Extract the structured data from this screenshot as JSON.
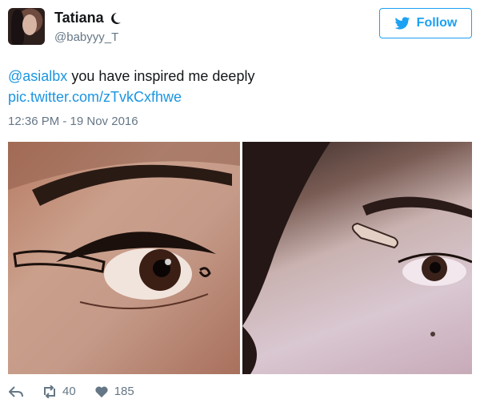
{
  "user": {
    "name": "Tatiana",
    "handle": "@babyyy_T",
    "name_icon": "crescent-moon-icon"
  },
  "follow": {
    "label": "Follow",
    "icon": "twitter-bird-icon"
  },
  "tweet": {
    "mention": "@asialbx",
    "text": " you have inspired me deeply",
    "link": "pic.twitter.com/zTvkCxfhwe",
    "timestamp": "12:36 PM - 19 Nov 2016"
  },
  "actions": {
    "reply_icon": "reply-icon",
    "retweet_icon": "retweet-icon",
    "retweets": "40",
    "like_icon": "heart-icon",
    "likes": "185"
  },
  "colors": {
    "accent": "#1da1f2",
    "link": "#1b95e0",
    "muted": "#657786",
    "text": "#14171a"
  }
}
